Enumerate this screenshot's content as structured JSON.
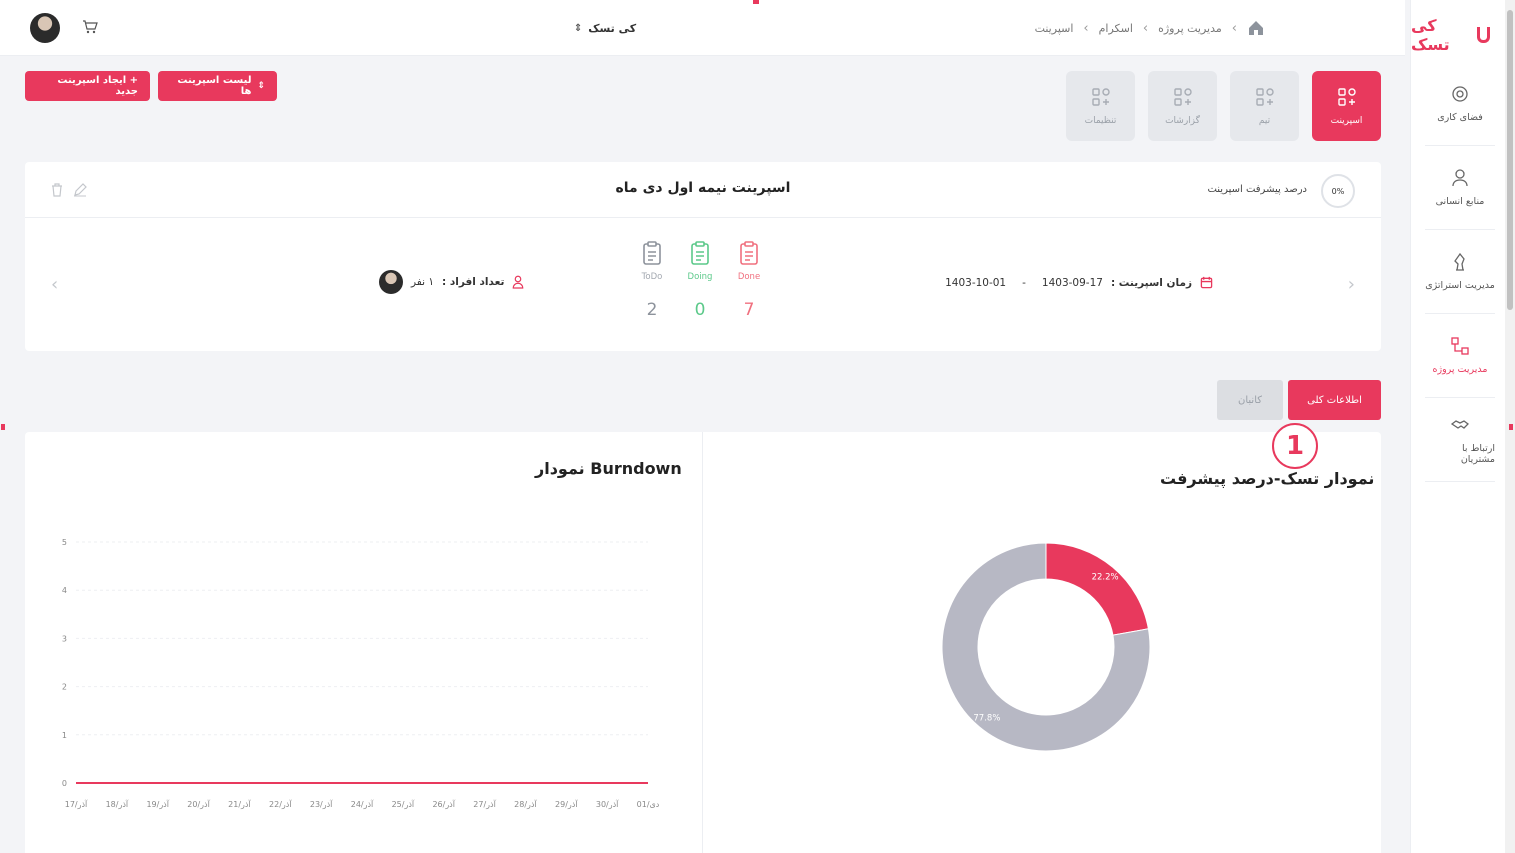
{
  "header": {
    "workspace_name": "کی تسک",
    "breadcrumb": [
      "مدیریت پروژه",
      "اسکرام",
      "اسپرینت"
    ]
  },
  "sidebar": {
    "logo_text": "کی تسک",
    "items": [
      {
        "label": "فضای کاری",
        "icon": "workspace-icon"
      },
      {
        "label": "منابع انسانی",
        "icon": "person-icon"
      },
      {
        "label": "مدیریت استراتژی",
        "icon": "strategy-icon"
      },
      {
        "label": "مدیریت پروژه",
        "icon": "project-icon",
        "active": true
      },
      {
        "label": "ارتباط با مشتریان",
        "icon": "handshake-icon"
      }
    ]
  },
  "tiles": [
    {
      "label": "اسپرینت",
      "active": true
    },
    {
      "label": "تیم"
    },
    {
      "label": "گزارشات"
    },
    {
      "label": "تنظیمات"
    }
  ],
  "actions": {
    "sprint_list": "لیست اسپرینت ها",
    "new_sprint": "+ ایجاد اسپرینت جدید"
  },
  "sprint": {
    "title": "اسپرینت نیمه اول دی ماه",
    "progress_label": "درصد پیشرفت اسپرینت",
    "progress_value": "0%",
    "time_label": "زمان اسپرینت :",
    "start": "1403-09-17",
    "dash": "-",
    "end": "1403-10-01",
    "members_label": "تعداد افراد :",
    "members_value": "۱ نفر",
    "stats": [
      {
        "label": "Done",
        "value": "7",
        "color": "#f0707f"
      },
      {
        "label": "Doing",
        "value": "0",
        "color": "#5cc98a"
      },
      {
        "label": "ToDo",
        "value": "2",
        "color": "#8d939c"
      }
    ]
  },
  "tabs": {
    "general": "اطلاعات کلی",
    "kanban": "کانبان",
    "marker": "1"
  },
  "charts": {
    "burndown_title": "نمودار Burndown",
    "donut_title": "نمودار تسک-درصد پیشرفت"
  },
  "colors": {
    "accent": "#e8395d",
    "gray_slice": "#b7b8c4"
  },
  "chart_data": [
    {
      "type": "line",
      "title": "نمودار Burndown",
      "x": [
        "17/آذر",
        "18/آذر",
        "19/آذر",
        "20/آذر",
        "21/آذر",
        "22/آذر",
        "23/آذر",
        "24/آذر",
        "25/آذر",
        "26/آذر",
        "27/آذر",
        "28/آذر",
        "29/آذر",
        "30/آذر",
        "01/دی"
      ],
      "series": [
        {
          "values": [
            0,
            0,
            0,
            0,
            0,
            0,
            0,
            0,
            0,
            0,
            0,
            0,
            0,
            0,
            0
          ]
        }
      ],
      "ylim": [
        0,
        5
      ],
      "yticks": [
        0,
        1,
        2,
        3,
        4,
        5
      ],
      "grid": true
    },
    {
      "type": "pie",
      "title": "نمودار تسک-درصد پیشرفت",
      "labels": [
        "22.2%",
        "77.8%"
      ],
      "values": [
        22.2,
        77.8
      ],
      "colors": [
        "#e8395d",
        "#b7b8c4"
      ],
      "donut": true
    }
  ]
}
